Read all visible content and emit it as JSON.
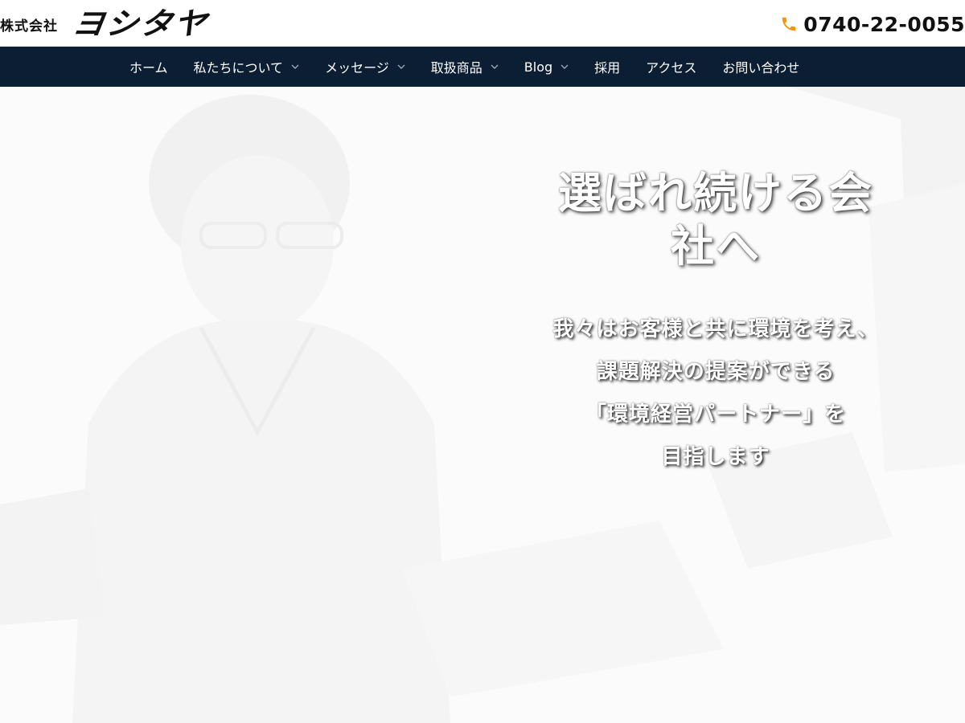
{
  "header": {
    "logo_prefix": "株式会社",
    "logo_name": "ヨシタヤ",
    "phone_icon": "phone-icon",
    "phone_number": "0740-22-0055"
  },
  "nav": {
    "items": [
      {
        "label": "ホーム",
        "has_dropdown": false
      },
      {
        "label": "私たちについて",
        "has_dropdown": true
      },
      {
        "label": "メッセージ",
        "has_dropdown": true
      },
      {
        "label": "取扱商品",
        "has_dropdown": true
      },
      {
        "label": "Blog",
        "has_dropdown": true
      },
      {
        "label": "採用",
        "has_dropdown": false
      },
      {
        "label": "アクセス",
        "has_dropdown": false
      },
      {
        "label": "お問い合わせ",
        "has_dropdown": false
      }
    ]
  },
  "hero": {
    "title_line1": "選ばれ続ける会",
    "title_line2": "社へ",
    "lines": [
      "我々はお客様と共に環境を考え、",
      "課題解決の提案ができる",
      "「環境経営パートナー」を",
      "目指します"
    ]
  },
  "colors": {
    "nav_bg": "#0c1e33",
    "phone_icon": "#f39800",
    "hero_text": "#ffffff"
  }
}
